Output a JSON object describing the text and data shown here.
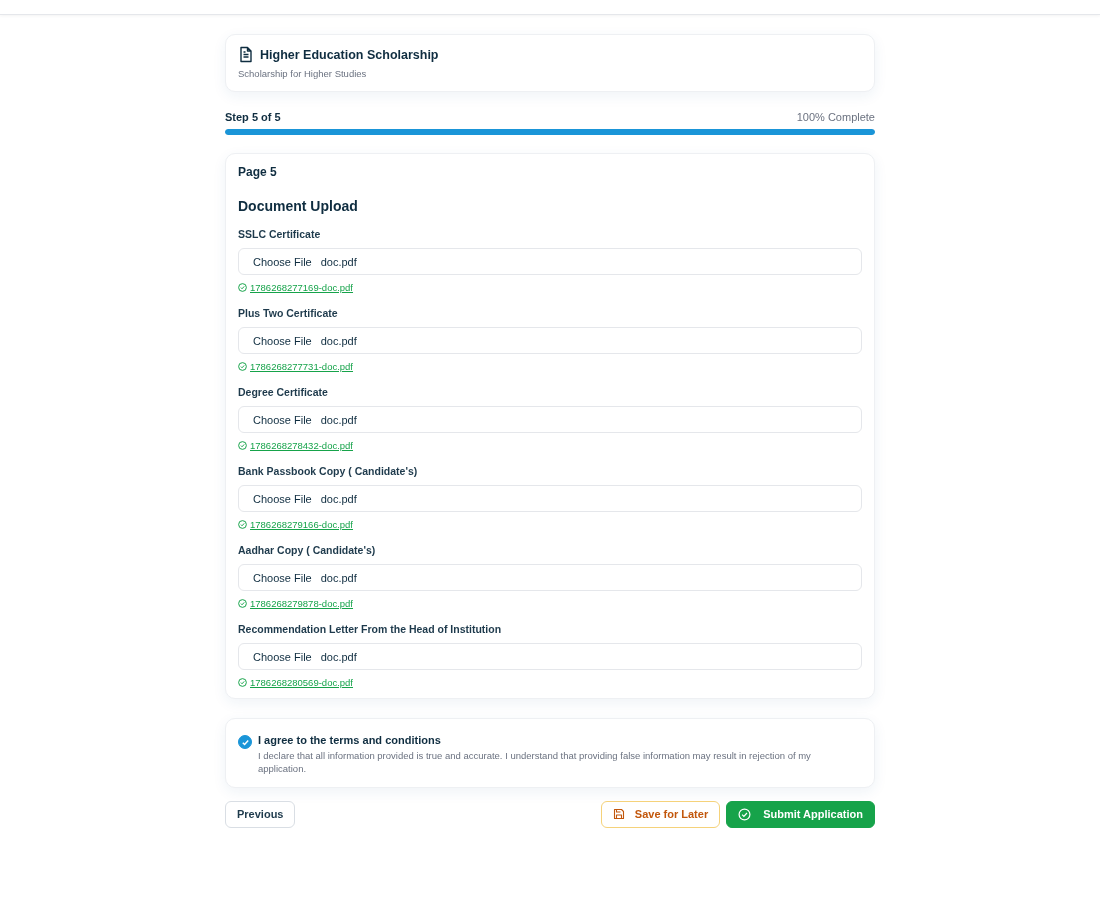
{
  "form": {
    "title": "Higher Education Scholarship",
    "subtitle": "Scholarship for Higher Studies"
  },
  "progress": {
    "step": "Step 5 of 5",
    "percent": "100% Complete",
    "level": 1
  },
  "page": {
    "label": "Page 5",
    "section": "Document Upload"
  },
  "uploads": [
    {
      "label": "SSLC Certificate",
      "button": "Choose File",
      "file": "doc.pdf",
      "link": "1786268277169-doc.pdf",
      "uploaded": true
    },
    {
      "label": "Plus Two Certificate",
      "button": "Choose File",
      "file": "doc.pdf",
      "link": "1786268277731-doc.pdf",
      "uploaded": true
    },
    {
      "label": "Degree Certificate",
      "button": "Choose File",
      "file": "doc.pdf",
      "link": "1786268278432-doc.pdf",
      "uploaded": true
    },
    {
      "label": "Bank Passbook Copy ( Candidate's)",
      "button": "Choose File",
      "file": "doc.pdf",
      "link": "1786268279166-doc.pdf",
      "uploaded": true
    },
    {
      "label": "Aadhar Copy ( Candidate's)",
      "button": "Choose File",
      "file": "doc.pdf",
      "link": "1786268279878-doc.pdf",
      "uploaded": true
    },
    {
      "label": "Recommendation Letter From the Head of Institution",
      "button": "Choose File",
      "file": "doc.pdf",
      "link": "1786268280569-doc.pdf",
      "uploaded": true
    }
  ],
  "agreement": {
    "checked": true,
    "title": "I agree to the terms and conditions",
    "text": "I declare that all information provided is true and accurate. I understand that providing false information may result in rejection of my application."
  },
  "buttons": {
    "previous": "Previous",
    "save": "Save for Later",
    "submit": "Submit Application"
  }
}
